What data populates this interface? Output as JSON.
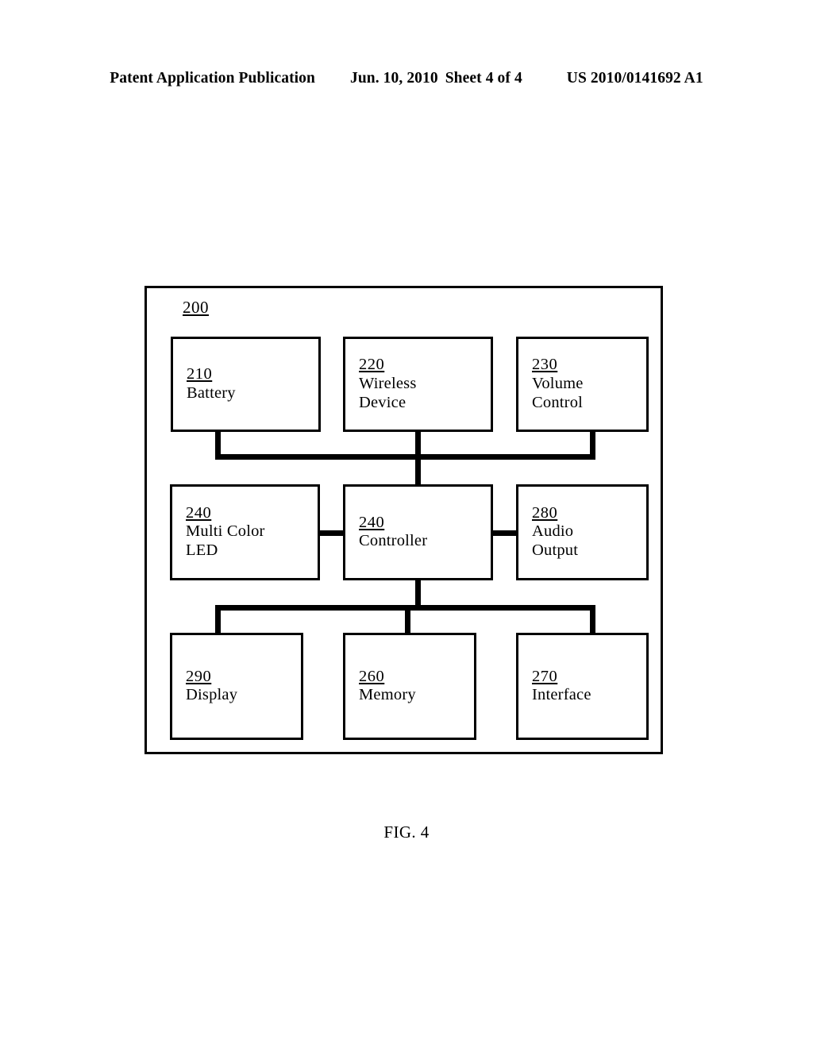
{
  "header": {
    "publication": "Patent Application Publication",
    "date": "Jun. 10, 2010",
    "sheet": "Sheet 4 of 4",
    "patent_number": "US 2010/0141692 A1"
  },
  "figure": {
    "caption": "FIG. 4",
    "system_ref": "200",
    "blocks": [
      {
        "ref": "210",
        "label": "Battery",
        "row": "top",
        "column": "left"
      },
      {
        "ref": "220",
        "label": "Wireless\nDevice",
        "row": "top",
        "column": "center"
      },
      {
        "ref": "230",
        "label": "Volume\nControl",
        "row": "top",
        "column": "right"
      },
      {
        "ref": "240",
        "label": "Multi Color\nLED",
        "row": "middle",
        "column": "left"
      },
      {
        "ref": "240",
        "label": "Controller",
        "row": "middle",
        "column": "center"
      },
      {
        "ref": "280",
        "label": "Audio\nOutput",
        "row": "middle",
        "column": "right"
      },
      {
        "ref": "290",
        "label": "Display",
        "row": "bottom",
        "column": "left"
      },
      {
        "ref": "260",
        "label": "Memory",
        "row": "bottom",
        "column": "center"
      },
      {
        "ref": "270",
        "label": "Interface",
        "row": "bottom",
        "column": "right"
      }
    ],
    "connections": [
      {
        "from": "210",
        "to": "240-controller",
        "via": "upper-bus"
      },
      {
        "from": "220",
        "to": "240-controller",
        "via": "upper-bus"
      },
      {
        "from": "230",
        "to": "240-controller",
        "via": "upper-bus"
      },
      {
        "from": "240-controller",
        "to": "240-led",
        "via": "direct"
      },
      {
        "from": "240-controller",
        "to": "280",
        "via": "direct"
      },
      {
        "from": "240-controller",
        "to": "290",
        "via": "lower-bus"
      },
      {
        "from": "240-controller",
        "to": "260",
        "via": "lower-bus"
      },
      {
        "from": "240-controller",
        "to": "270",
        "via": "lower-bus"
      }
    ]
  },
  "colors": {
    "ink": "#000000",
    "paper": "#ffffff"
  }
}
